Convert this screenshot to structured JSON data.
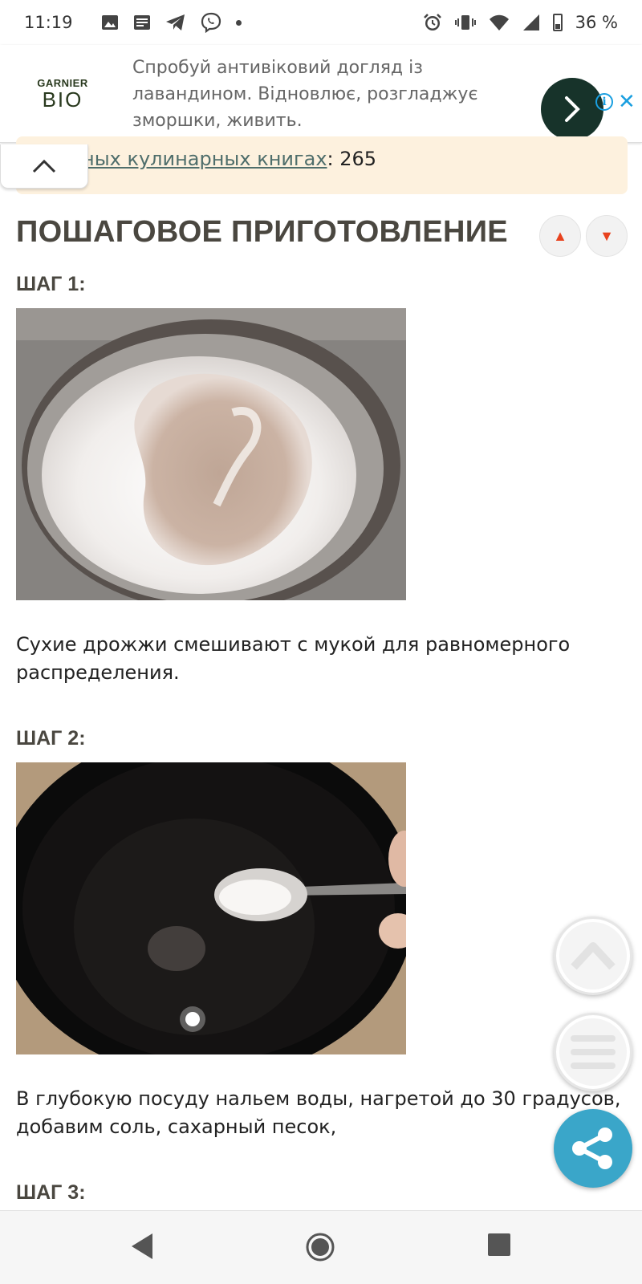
{
  "status_bar": {
    "time": "11:19",
    "battery": "36 %",
    "icons": [
      "image-icon",
      "news-icon",
      "telegram-icon",
      "viber-icon",
      "dot-icon",
      "alarm-icon",
      "vibrate-icon",
      "wifi-icon",
      "signal-icon",
      "battery-icon"
    ]
  },
  "ad": {
    "brand_top": "GARNIER",
    "brand_bottom": "BIO",
    "text": "Спробуй антивіковий догляд із лавандином. Відновлює, розгладжує зморшки, живить.",
    "go_icon": "chevron-right-icon",
    "info_icon": "info-icon",
    "close_icon": "close-icon"
  },
  "notice": {
    "link_text": "ных кулинарных книгах",
    "count": ": 265"
  },
  "section": {
    "title": "ПОШАГОВОЕ ПРИГОТОВЛЕНИЕ"
  },
  "steps": [
    {
      "label": "ШАГ 1:",
      "text": "Сухие дрожжи смешивают с мукой для равномерного распределения."
    },
    {
      "label": "ШАГ 2:",
      "text": "В глубокую посуду нальем воды, нагретой до 30 градусов, добавим соль, сахарный песок,"
    },
    {
      "label": "ШАГ 3:"
    }
  ],
  "colors": {
    "accent_red": "#e8421e",
    "share": "#3aa6c9",
    "notice_bg": "#fdf1de",
    "ad_button": "#17332a",
    "heading": "#4a4740"
  }
}
